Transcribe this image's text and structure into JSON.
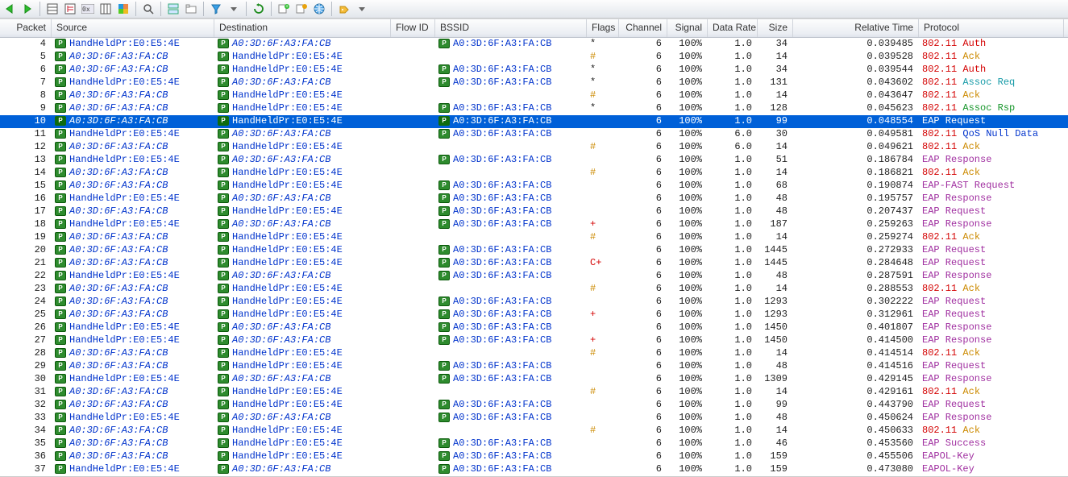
{
  "columns": [
    "Packet",
    "Source",
    "Destination",
    "Flow ID",
    "BSSID",
    "Flags",
    "Channel",
    "Signal",
    "Data Rate",
    "Size",
    "Relative Time",
    "Protocol"
  ],
  "mac": {
    "hand": "HandHeldPr:E0:E5:4E",
    "ap": "A0:3D:6F:A3:FA:CB"
  },
  "selected_packet": 10,
  "rows": [
    {
      "pkt": 4,
      "src": "hand",
      "dst": "ap",
      "bssid": "ap",
      "flags": "*",
      "ch": 6,
      "sig": "100%",
      "rate": "1.0",
      "size": 34,
      "time": "0.039485",
      "proto_pref": "802.11",
      "proto_suf": "Auth",
      "src_i": false,
      "dst_i": true,
      "pcolor": "red"
    },
    {
      "pkt": 5,
      "src": "ap",
      "dst": "hand",
      "bssid": "",
      "flags": "#",
      "ch": 6,
      "sig": "100%",
      "rate": "1.0",
      "size": 14,
      "time": "0.039528",
      "proto_pref": "802.11",
      "proto_suf": "Ack",
      "src_i": true,
      "dst_i": false,
      "pcolor": "orange"
    },
    {
      "pkt": 6,
      "src": "ap",
      "dst": "hand",
      "bssid": "ap",
      "flags": "*",
      "ch": 6,
      "sig": "100%",
      "rate": "1.0",
      "size": 34,
      "time": "0.039544",
      "proto_pref": "802.11",
      "proto_suf": "Auth",
      "src_i": true,
      "dst_i": false,
      "pcolor": "red"
    },
    {
      "pkt": 7,
      "src": "hand",
      "dst": "ap",
      "bssid": "ap",
      "flags": "*",
      "ch": 6,
      "sig": "100%",
      "rate": "1.0",
      "size": 131,
      "time": "0.043602",
      "proto_pref": "802.11",
      "proto_suf": "Assoc Req",
      "src_i": false,
      "dst_i": true,
      "pcolor": "teal"
    },
    {
      "pkt": 8,
      "src": "ap",
      "dst": "hand",
      "bssid": "",
      "flags": "#",
      "ch": 6,
      "sig": "100%",
      "rate": "1.0",
      "size": 14,
      "time": "0.043647",
      "proto_pref": "802.11",
      "proto_suf": "Ack",
      "src_i": true,
      "dst_i": false,
      "pcolor": "orange"
    },
    {
      "pkt": 9,
      "src": "ap",
      "dst": "hand",
      "bssid": "ap",
      "flags": "*",
      "ch": 6,
      "sig": "100%",
      "rate": "1.0",
      "size": 128,
      "time": "0.045623",
      "proto_pref": "802.11",
      "proto_suf": "Assoc Rsp",
      "src_i": true,
      "dst_i": false,
      "pcolor": "green"
    },
    {
      "pkt": 10,
      "src": "ap",
      "dst": "hand",
      "bssid": "ap",
      "flags": "",
      "ch": 6,
      "sig": "100%",
      "rate": "1.0",
      "size": 99,
      "time": "0.048554",
      "proto_pref": "",
      "proto_suf": "EAP Request",
      "src_i": true,
      "dst_i": false,
      "pcolor": "purple",
      "selected": true
    },
    {
      "pkt": 11,
      "src": "hand",
      "dst": "ap",
      "bssid": "ap",
      "flags": "",
      "ch": 6,
      "sig": "100%",
      "rate": "6.0",
      "size": 30,
      "time": "0.049581",
      "proto_pref": "802.11",
      "proto_suf": "QoS Null Data",
      "src_i": false,
      "dst_i": true,
      "pcolor": "blue"
    },
    {
      "pkt": 12,
      "src": "ap",
      "dst": "hand",
      "bssid": "",
      "flags": "#",
      "ch": 6,
      "sig": "100%",
      "rate": "6.0",
      "size": 14,
      "time": "0.049621",
      "proto_pref": "802.11",
      "proto_suf": "Ack",
      "src_i": true,
      "dst_i": false,
      "pcolor": "orange"
    },
    {
      "pkt": 13,
      "src": "hand",
      "dst": "ap",
      "bssid": "ap",
      "flags": "",
      "ch": 6,
      "sig": "100%",
      "rate": "1.0",
      "size": 51,
      "time": "0.186784",
      "proto_pref": "",
      "proto_suf": "EAP Response",
      "src_i": false,
      "dst_i": true,
      "pcolor": "purple"
    },
    {
      "pkt": 14,
      "src": "ap",
      "dst": "hand",
      "bssid": "",
      "flags": "#",
      "ch": 6,
      "sig": "100%",
      "rate": "1.0",
      "size": 14,
      "time": "0.186821",
      "proto_pref": "802.11",
      "proto_suf": "Ack",
      "src_i": true,
      "dst_i": false,
      "pcolor": "orange"
    },
    {
      "pkt": 15,
      "src": "ap",
      "dst": "hand",
      "bssid": "ap",
      "flags": "",
      "ch": 6,
      "sig": "100%",
      "rate": "1.0",
      "size": 68,
      "time": "0.190874",
      "proto_pref": "",
      "proto_suf": "EAP-FAST Request",
      "src_i": true,
      "dst_i": false,
      "pcolor": "purple"
    },
    {
      "pkt": 16,
      "src": "hand",
      "dst": "ap",
      "bssid": "ap",
      "flags": "",
      "ch": 6,
      "sig": "100%",
      "rate": "1.0",
      "size": 48,
      "time": "0.195757",
      "proto_pref": "",
      "proto_suf": "EAP Response",
      "src_i": false,
      "dst_i": true,
      "pcolor": "purple"
    },
    {
      "pkt": 17,
      "src": "ap",
      "dst": "hand",
      "bssid": "ap",
      "flags": "",
      "ch": 6,
      "sig": "100%",
      "rate": "1.0",
      "size": 48,
      "time": "0.207437",
      "proto_pref": "",
      "proto_suf": "EAP Request",
      "src_i": true,
      "dst_i": false,
      "pcolor": "purple"
    },
    {
      "pkt": 18,
      "src": "hand",
      "dst": "ap",
      "bssid": "ap",
      "flags": "+",
      "ch": 6,
      "sig": "100%",
      "rate": "1.0",
      "size": 187,
      "time": "0.259263",
      "proto_pref": "",
      "proto_suf": "EAP Response",
      "src_i": false,
      "dst_i": true,
      "pcolor": "purple"
    },
    {
      "pkt": 19,
      "src": "ap",
      "dst": "hand",
      "bssid": "",
      "flags": "#",
      "ch": 6,
      "sig": "100%",
      "rate": "1.0",
      "size": 14,
      "time": "0.259274",
      "proto_pref": "802.11",
      "proto_suf": "Ack",
      "src_i": true,
      "dst_i": false,
      "pcolor": "orange"
    },
    {
      "pkt": 20,
      "src": "ap",
      "dst": "hand",
      "bssid": "ap",
      "flags": "",
      "ch": 6,
      "sig": "100%",
      "rate": "1.0",
      "size": 1445,
      "time": "0.272933",
      "proto_pref": "",
      "proto_suf": "EAP Request",
      "src_i": true,
      "dst_i": false,
      "pcolor": "purple"
    },
    {
      "pkt": 21,
      "src": "ap",
      "dst": "hand",
      "bssid": "ap",
      "flags": "C+",
      "ch": 6,
      "sig": "100%",
      "rate": "1.0",
      "size": 1445,
      "time": "0.284648",
      "proto_pref": "",
      "proto_suf": "EAP Request",
      "src_i": true,
      "dst_i": false,
      "pcolor": "purple"
    },
    {
      "pkt": 22,
      "src": "hand",
      "dst": "ap",
      "bssid": "ap",
      "flags": "",
      "ch": 6,
      "sig": "100%",
      "rate": "1.0",
      "size": 48,
      "time": "0.287591",
      "proto_pref": "",
      "proto_suf": "EAP Response",
      "src_i": false,
      "dst_i": true,
      "pcolor": "purple"
    },
    {
      "pkt": 23,
      "src": "ap",
      "dst": "hand",
      "bssid": "",
      "flags": "#",
      "ch": 6,
      "sig": "100%",
      "rate": "1.0",
      "size": 14,
      "time": "0.288553",
      "proto_pref": "802.11",
      "proto_suf": "Ack",
      "src_i": true,
      "dst_i": false,
      "pcolor": "orange"
    },
    {
      "pkt": 24,
      "src": "ap",
      "dst": "hand",
      "bssid": "ap",
      "flags": "",
      "ch": 6,
      "sig": "100%",
      "rate": "1.0",
      "size": 1293,
      "time": "0.302222",
      "proto_pref": "",
      "proto_suf": "EAP Request",
      "src_i": true,
      "dst_i": false,
      "pcolor": "purple"
    },
    {
      "pkt": 25,
      "src": "ap",
      "dst": "hand",
      "bssid": "ap",
      "flags": "+",
      "ch": 6,
      "sig": "100%",
      "rate": "1.0",
      "size": 1293,
      "time": "0.312961",
      "proto_pref": "",
      "proto_suf": "EAP Request",
      "src_i": true,
      "dst_i": false,
      "pcolor": "purple"
    },
    {
      "pkt": 26,
      "src": "hand",
      "dst": "ap",
      "bssid": "ap",
      "flags": "",
      "ch": 6,
      "sig": "100%",
      "rate": "1.0",
      "size": 1450,
      "time": "0.401807",
      "proto_pref": "",
      "proto_suf": "EAP Response",
      "src_i": false,
      "dst_i": true,
      "pcolor": "purple"
    },
    {
      "pkt": 27,
      "src": "hand",
      "dst": "ap",
      "bssid": "ap",
      "flags": "+",
      "ch": 6,
      "sig": "100%",
      "rate": "1.0",
      "size": 1450,
      "time": "0.414500",
      "proto_pref": "",
      "proto_suf": "EAP Response",
      "src_i": false,
      "dst_i": true,
      "pcolor": "purple"
    },
    {
      "pkt": 28,
      "src": "ap",
      "dst": "hand",
      "bssid": "",
      "flags": "#",
      "ch": 6,
      "sig": "100%",
      "rate": "1.0",
      "size": 14,
      "time": "0.414514",
      "proto_pref": "802.11",
      "proto_suf": "Ack",
      "src_i": true,
      "dst_i": false,
      "pcolor": "orange"
    },
    {
      "pkt": 29,
      "src": "ap",
      "dst": "hand",
      "bssid": "ap",
      "flags": "",
      "ch": 6,
      "sig": "100%",
      "rate": "1.0",
      "size": 48,
      "time": "0.414516",
      "proto_pref": "",
      "proto_suf": "EAP Request",
      "src_i": true,
      "dst_i": false,
      "pcolor": "purple"
    },
    {
      "pkt": 30,
      "src": "hand",
      "dst": "ap",
      "bssid": "ap",
      "flags": "",
      "ch": 6,
      "sig": "100%",
      "rate": "1.0",
      "size": 1309,
      "time": "0.429145",
      "proto_pref": "",
      "proto_suf": "EAP Response",
      "src_i": false,
      "dst_i": true,
      "pcolor": "purple"
    },
    {
      "pkt": 31,
      "src": "ap",
      "dst": "hand",
      "bssid": "",
      "flags": "#",
      "ch": 6,
      "sig": "100%",
      "rate": "1.0",
      "size": 14,
      "time": "0.429161",
      "proto_pref": "802.11",
      "proto_suf": "Ack",
      "src_i": true,
      "dst_i": false,
      "pcolor": "orange"
    },
    {
      "pkt": 32,
      "src": "ap",
      "dst": "hand",
      "bssid": "ap",
      "flags": "",
      "ch": 6,
      "sig": "100%",
      "rate": "1.0",
      "size": 99,
      "time": "0.443790",
      "proto_pref": "",
      "proto_suf": "EAP Request",
      "src_i": true,
      "dst_i": false,
      "pcolor": "purple"
    },
    {
      "pkt": 33,
      "src": "hand",
      "dst": "ap",
      "bssid": "ap",
      "flags": "",
      "ch": 6,
      "sig": "100%",
      "rate": "1.0",
      "size": 48,
      "time": "0.450624",
      "proto_pref": "",
      "proto_suf": "EAP Response",
      "src_i": false,
      "dst_i": true,
      "pcolor": "purple"
    },
    {
      "pkt": 34,
      "src": "ap",
      "dst": "hand",
      "bssid": "",
      "flags": "#",
      "ch": 6,
      "sig": "100%",
      "rate": "1.0",
      "size": 14,
      "time": "0.450633",
      "proto_pref": "802.11",
      "proto_suf": "Ack",
      "src_i": true,
      "dst_i": false,
      "pcolor": "orange"
    },
    {
      "pkt": 35,
      "src": "ap",
      "dst": "hand",
      "bssid": "ap",
      "flags": "",
      "ch": 6,
      "sig": "100%",
      "rate": "1.0",
      "size": 46,
      "time": "0.453560",
      "proto_pref": "",
      "proto_suf": "EAP Success",
      "src_i": true,
      "dst_i": false,
      "pcolor": "purple"
    },
    {
      "pkt": 36,
      "src": "ap",
      "dst": "hand",
      "bssid": "ap",
      "flags": "",
      "ch": 6,
      "sig": "100%",
      "rate": "1.0",
      "size": 159,
      "time": "0.455506",
      "proto_pref": "",
      "proto_suf": "EAPOL-Key",
      "src_i": true,
      "dst_i": false,
      "pcolor": "purple"
    },
    {
      "pkt": 37,
      "src": "hand",
      "dst": "ap",
      "bssid": "ap",
      "flags": "",
      "ch": 6,
      "sig": "100%",
      "rate": "1.0",
      "size": 159,
      "time": "0.473080",
      "proto_pref": "",
      "proto_suf": "EAPOL-Key",
      "src_i": false,
      "dst_i": true,
      "pcolor": "purple"
    }
  ]
}
